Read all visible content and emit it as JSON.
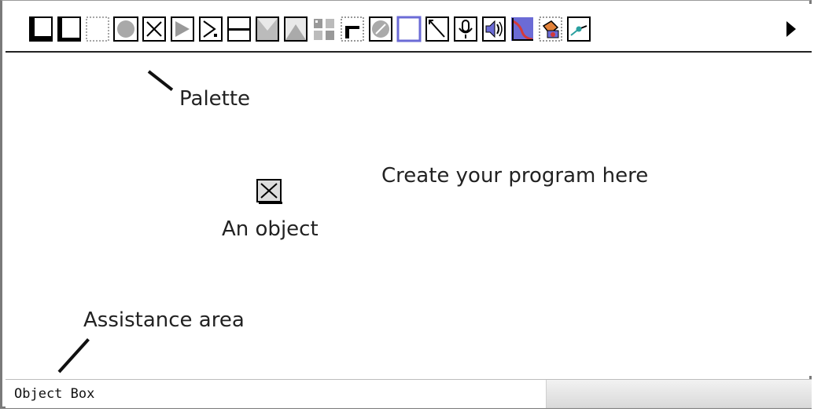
{
  "palette": {
    "tools": [
      {
        "icon": "field-tool-icon"
      },
      {
        "icon": "scroll-field-tool-icon"
      },
      {
        "icon": "rectangle-tool-icon"
      },
      {
        "icon": "circle-tool-icon"
      },
      {
        "icon": "x-button-tool-icon"
      },
      {
        "icon": "triangle-tool-icon"
      },
      {
        "icon": "triangle-dot-tool-icon"
      },
      {
        "icon": "line-tool-icon"
      },
      {
        "icon": "shape-down-tool-icon"
      },
      {
        "icon": "shape-up-tool-icon"
      },
      {
        "icon": "grid-tool-icon"
      },
      {
        "icon": "card-tool-icon"
      },
      {
        "icon": "disc-tool-icon"
      },
      {
        "icon": "blank-rect-tool-icon"
      },
      {
        "icon": "diagonal-tool-icon"
      },
      {
        "icon": "microphone-icon"
      },
      {
        "icon": "speaker-icon"
      },
      {
        "icon": "graph-icon"
      },
      {
        "icon": "paint-bucket-icon"
      },
      {
        "icon": "pen-tool-icon"
      }
    ],
    "more_icon": "more-arrow-icon",
    "annotation": "Palette"
  },
  "canvas": {
    "message": "Create your program here",
    "object_label": "An object",
    "object_icon": "object-x-icon"
  },
  "assistance": {
    "annotation": "Assistance area"
  },
  "status_bar": {
    "text": "Object Box"
  },
  "colors": {
    "palette_border": "#222222",
    "window_frame": "#7a7a7a",
    "status_bg": "#e6e6e6",
    "accent_blue": "#6b6bd6",
    "accent_red": "#d43a3a"
  }
}
